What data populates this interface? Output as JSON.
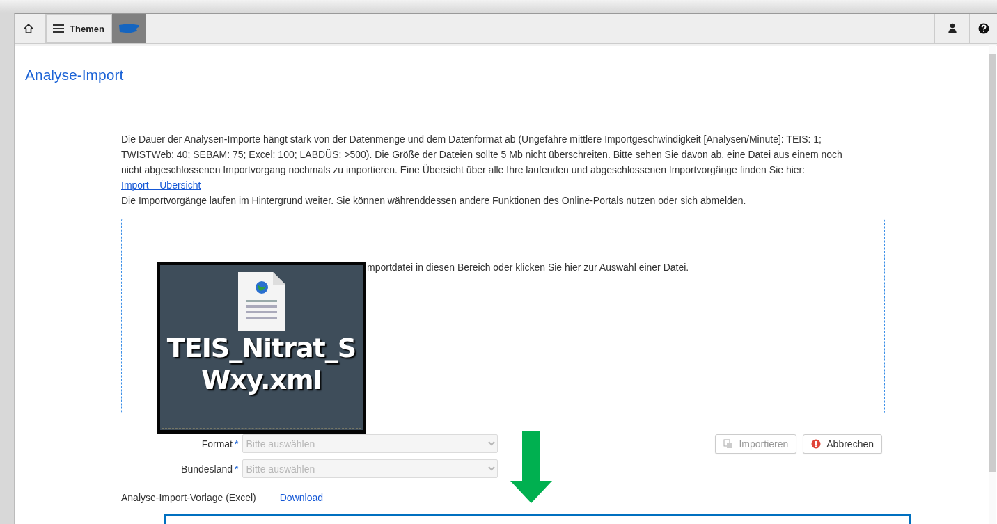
{
  "toolbar": {
    "themes_button": "Themen"
  },
  "page": {
    "title": "Analyse-Import",
    "intro": "Die Dauer der Analysen-Importe hängt stark von der Datenmenge und dem Datenformat ab (Ungefähre mittlere Importgeschwindigkeit [Analysen/Minute]: TEIS: 1; TWISTWeb: 40; SEBAM: 75; Excel: 100; LABDÜS: >500). Die Größe der Dateien sollte 5 Mb nicht überschreiten. Bitte sehen Sie davon ab, eine Datei aus einem noch nicht abgeschlossenen Importvorgang nochmals zu importieren. Eine Übersicht über alle Ihre laufenden und abgeschlossenen Importvorgänge finden Sie hier:",
    "overview_link": "Import – Übersicht",
    "note": "Die Importvorgänge laufen im Hintergrund weiter. Sie können währenddessen andere Funktionen des Online-Portals nutzen oder sich abmelden.",
    "drop_zone": {
      "text": "mportdatei in diesen Bereich oder klicken Sie hier zur Auswahl einer Datei."
    },
    "fields": [
      {
        "label": "Format",
        "required_mark": "*",
        "placeholder": "Bitte auswählen",
        "disabled": true
      },
      {
        "label": "Bundesland",
        "required_mark": "*",
        "placeholder": "Bitte auswählen",
        "disabled": true
      }
    ],
    "buttons": [
      {
        "kind": "import",
        "label": "Importieren",
        "disabled": true
      },
      {
        "kind": "cancel",
        "label": "Abbrechen",
        "disabled": false
      }
    ],
    "template": {
      "label": "Analyse-Import-Vorlage (Excel)",
      "link": "Download"
    }
  },
  "dragged_file": {
    "name_lines": [
      "TEIS_Nitrat_S",
      "Wxy.xml"
    ]
  }
}
